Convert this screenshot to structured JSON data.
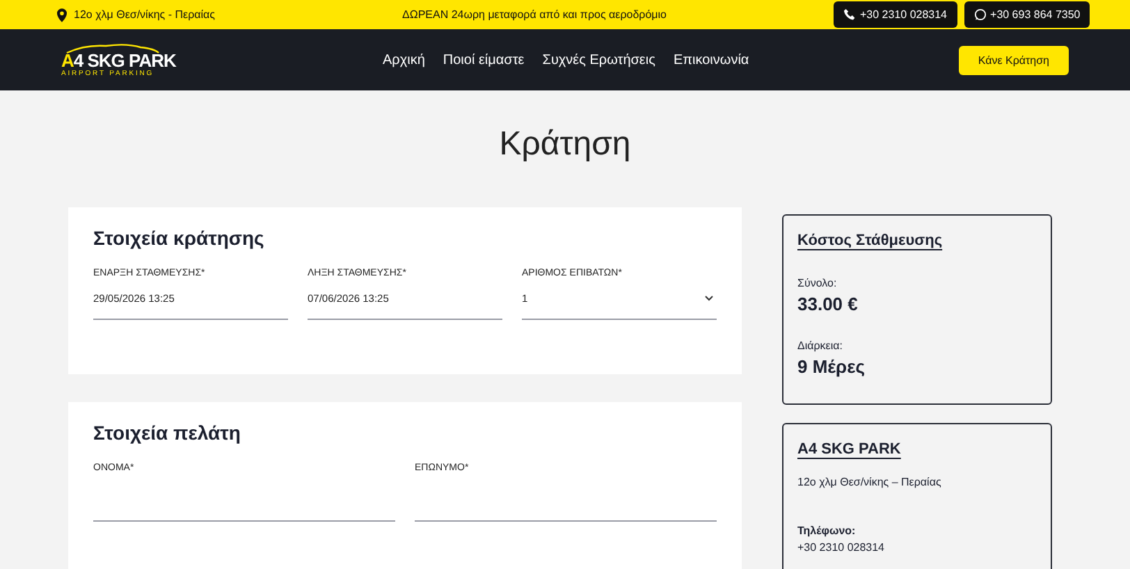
{
  "top_bar": {
    "address": "12ο χλμ Θεσ/νίκης - Περαίας",
    "promo": "ΔΩΡΕΑΝ 24ωρη μεταφορά από και προς αεροδρόμιο",
    "phones": [
      {
        "kind": "phone",
        "number": "+30 2310 028314"
      },
      {
        "kind": "whatsapp",
        "number": "+30 693 864 7350"
      }
    ]
  },
  "nav": {
    "logo": {
      "title": "A4 SKG PARK",
      "subtitle": "AIRPORT PARKING"
    },
    "links": [
      "Αρχική",
      "Ποιοί είμαστε",
      "Συχνές Ερωτήσεις",
      "Επικοινωνία"
    ],
    "cta": "Κάνε Κράτηση"
  },
  "page_title": "Κράτηση",
  "booking": {
    "title": "Στοιχεία κράτησης",
    "fields": [
      {
        "kind": "text",
        "label": "ΕΝΑΡΞΗ ΣΤΑΘΜΕΥΣΗΣ*",
        "value": "29/05/2026 13:25"
      },
      {
        "kind": "text",
        "label": "ΛΗΞΗ ΣΤΑΘΜΕΥΣΗΣ*",
        "value": "07/06/2026 13:25"
      },
      {
        "kind": "select",
        "label": "ΑΡΙΘΜΟΣ ΕΠΙΒΑΤΩΝ*",
        "value": "1"
      }
    ]
  },
  "customer": {
    "title": "Στοιχεία πελάτη",
    "fields": [
      {
        "label": "ΟΝΟΜΑ*"
      },
      {
        "label": "ΕΠΩΝΥΜΟ*"
      }
    ]
  },
  "cost": {
    "title": "Κόστος Στάθμευσης",
    "items": [
      {
        "label": "Σύνολο:",
        "value": "33.00 €"
      },
      {
        "label": "Διάρκεια:",
        "value": "9 Μέρες"
      }
    ]
  },
  "company": {
    "title": "A4 SKG PARK",
    "address": "12ο χλμ Θεσ/νίκης – Περαίας",
    "phone_label": "Τηλέφωνο:",
    "phone": "+30 2310 028314"
  }
}
